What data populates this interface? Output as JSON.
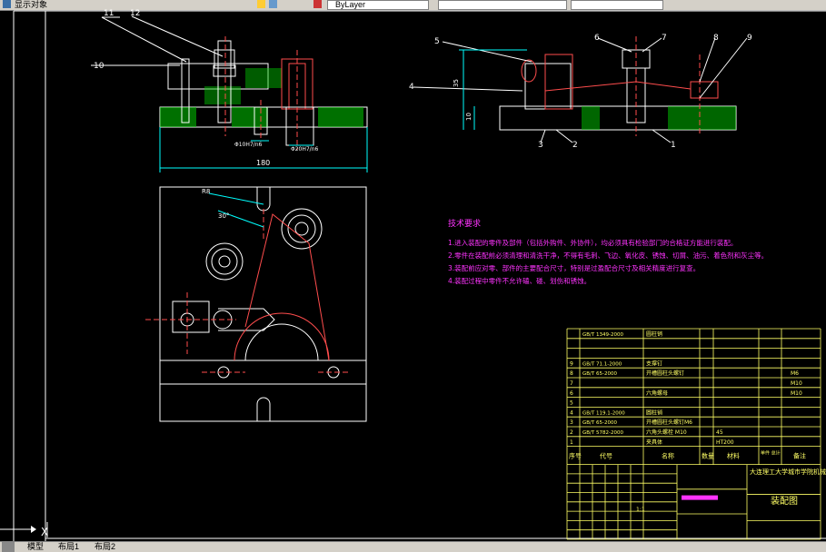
{
  "toolbar": {
    "left_text": "显示对象",
    "combo_text": "ByLayer",
    "icons": [
      "layer-icon",
      "save-icon",
      "properties-icon",
      "color-icon"
    ]
  },
  "drawing": {
    "callouts_left": [
      "11",
      "12",
      "10"
    ],
    "callouts_right": [
      "5",
      "6",
      "7",
      "8",
      "9",
      "4",
      "1",
      "2",
      "3"
    ],
    "dim_left_bottom": "180",
    "dim_left_a": "Φ10H7/n6",
    "dim_left_b": "Φ20H7/n6",
    "dim_right_height": "35",
    "dim_right_small": "10",
    "dim_topview_a": "R8",
    "dim_topview_b": "30°"
  },
  "tech_requirements": {
    "title": "技术要求",
    "items": [
      "1.进入装配的零件及部件（包括外购件、外协件），均必须具有检验部门的合格证方能进行装配。",
      "2.零件在装配前必须清理和清洗干净，不得有毛刺、飞边、氧化皮、锈蚀、切屑、油污、着色剂和灰尘等。",
      "3.装配前应对零、部件的主要配合尺寸，特别是过盈配合尺寸及相关精度进行复查。",
      "4.装配过程中零件不允许磕、碰、划伤和锈蚀。"
    ]
  },
  "parts_list": {
    "rows": [
      {
        "no": "",
        "code": "GB/T 1349-2000",
        "name": "圆柱销",
        "qty": "",
        "mat": "",
        "note": ""
      },
      {
        "no": "",
        "code": "",
        "name": "",
        "qty": "",
        "mat": "",
        "note": ""
      },
      {
        "no": "",
        "code": "",
        "name": "",
        "qty": "",
        "mat": "",
        "note": ""
      },
      {
        "no": "9",
        "code": "GB/T 71.1-2000",
        "name": "支撑钉",
        "qty": "",
        "mat": "",
        "note": ""
      },
      {
        "no": "8",
        "code": "GB/T 65-2000",
        "name": "开槽圆柱头螺钉",
        "qty": "",
        "mat": "",
        "note": "M6"
      },
      {
        "no": "7",
        "code": "",
        "name": "",
        "qty": "",
        "mat": "",
        "note": "M10"
      },
      {
        "no": "6",
        "code": "",
        "name": "六角螺母",
        "qty": "",
        "mat": "",
        "note": "M10"
      },
      {
        "no": "5",
        "code": "",
        "name": "",
        "qty": "",
        "mat": "",
        "note": ""
      },
      {
        "no": "4",
        "code": "GB/T 119.1-2000",
        "name": "圆柱销",
        "qty": "",
        "mat": "",
        "note": ""
      },
      {
        "no": "3",
        "code": "GB/T 65-2000",
        "name": "开槽圆柱头螺钉M6",
        "qty": "",
        "mat": "",
        "note": ""
      },
      {
        "no": "2",
        "code": "GB/T 5782-2000",
        "name": "六角头螺栓 M10",
        "qty": "",
        "mat": "45",
        "note": ""
      },
      {
        "no": "1",
        "code": "",
        "name": "夹具体",
        "qty": "",
        "mat": "HT200",
        "note": ""
      }
    ],
    "header": {
      "no": "序号",
      "code": "代号",
      "name": "名称",
      "qty": "数量",
      "mat": "材料",
      "weight": "单件 总计",
      "note": "备注"
    }
  },
  "title_block": {
    "school": "大连理工大学城市学院机械学院",
    "drawing_name": "装配图",
    "ratio": "1:1"
  },
  "bottom_tabs": [
    "模型",
    "布局1",
    "布局2"
  ],
  "accent": {
    "line": "#ffffff",
    "text_magenta": "#ff33ff",
    "title_block": "#ffff66",
    "hatch": "#00ff00",
    "part": "#ff4d4d",
    "cyan": "#00ffff"
  }
}
